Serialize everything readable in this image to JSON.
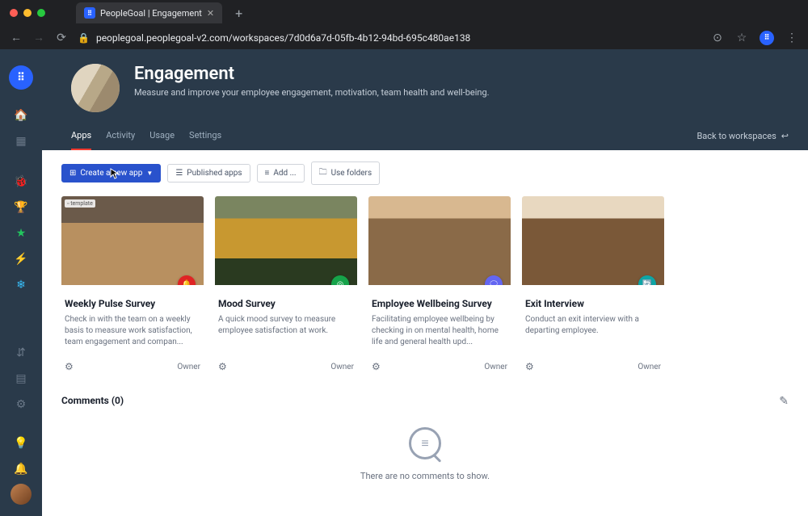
{
  "browser": {
    "tab_title": "PeopleGoal | Engagement",
    "url": "peoplegoal.peoplegoal-v2.com/workspaces/7d0d6a7d-05fb-4b12-94bd-695c480ae138"
  },
  "workspace": {
    "title": "Engagement",
    "subtitle": "Measure and improve your employee engagement, motivation, team health and well-being."
  },
  "nav": {
    "tabs": [
      "Apps",
      "Activity",
      "Usage",
      "Settings"
    ],
    "active": "Apps",
    "back_label": "Back to workspaces"
  },
  "actions": {
    "create": "Create a new app",
    "published": "Published apps",
    "add": "Add ...",
    "folders": "Use folders"
  },
  "apps": [
    {
      "title": "Weekly Pulse Survey",
      "desc": "Check in with the team on a weekly basis to measure work satisfaction, team engagement and compan...",
      "role": "Owner",
      "icon": "🔔",
      "icon_bg": "#e02424"
    },
    {
      "title": "Mood Survey",
      "desc": "A quick mood survey to measure employee satisfaction at work.",
      "role": "Owner",
      "icon": "◎",
      "icon_bg": "#16a34a"
    },
    {
      "title": "Employee Wellbeing Survey",
      "desc": "Facilitating employee wellbeing by checking in on mental health, home life and general health upd...",
      "role": "Owner",
      "icon": "🗨",
      "icon_bg": "#6366f1"
    },
    {
      "title": "Exit Interview",
      "desc": "Conduct an exit interview with a departing employee.",
      "role": "Owner",
      "icon": "🔄",
      "icon_bg": "#0ea5a5"
    }
  ],
  "comments": {
    "heading": "Comments (0)",
    "empty": "There are no comments to show."
  }
}
